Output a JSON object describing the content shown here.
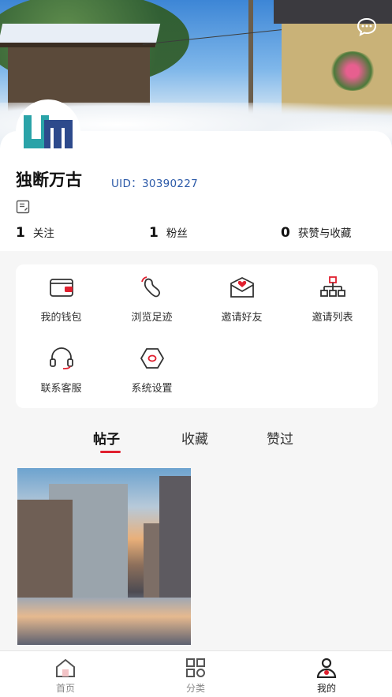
{
  "header": {
    "message_icon": "chat-bubble-icon"
  },
  "profile": {
    "nickname": "独断万古",
    "uid": "UID：30390227",
    "avatar_icon": "logo-avatar",
    "note_icon": "note-icon"
  },
  "stats": [
    {
      "value": "1",
      "label": "关注"
    },
    {
      "value": "1",
      "label": "粉丝"
    },
    {
      "value": "0",
      "label": "获赞与收藏"
    }
  ],
  "menu": [
    {
      "label": "我的钱包",
      "icon": "wallet-icon"
    },
    {
      "label": "浏览足迹",
      "icon": "footprint-icon"
    },
    {
      "label": "邀请好友",
      "icon": "invite-mail-icon"
    },
    {
      "label": "邀请列表",
      "icon": "org-chart-icon"
    },
    {
      "label": "联系客服",
      "icon": "headset-icon"
    },
    {
      "label": "系统设置",
      "icon": "settings-hex-icon"
    }
  ],
  "tabs": [
    {
      "label": "帖子",
      "active": true
    },
    {
      "label": "收藏",
      "active": false
    },
    {
      "label": "赞过",
      "active": false
    }
  ],
  "bottom_nav": [
    {
      "label": "首页",
      "icon": "home-icon"
    },
    {
      "label": "分类",
      "icon": "grid-icon"
    },
    {
      "label": "我的",
      "icon": "person-icon",
      "active": true
    }
  ],
  "colors": {
    "accent": "#e0202f",
    "uid": "#2c5aa8",
    "logo_teal": "#2aa3a8",
    "logo_navy": "#2d4a8c"
  }
}
